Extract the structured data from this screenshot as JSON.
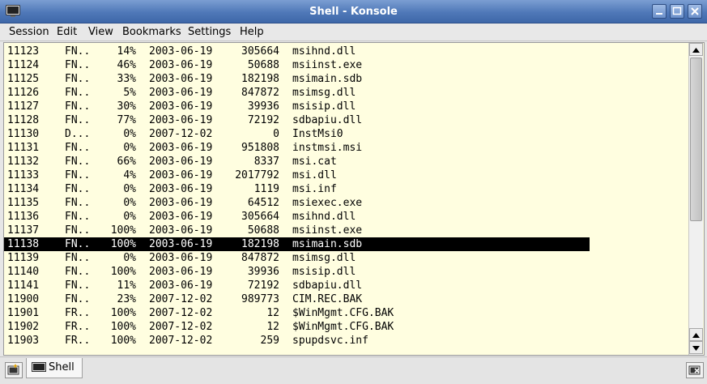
{
  "window": {
    "title": "Shell - Konsole"
  },
  "menu": [
    "Session",
    "Edit",
    "View",
    "Bookmarks",
    "Settings",
    "Help"
  ],
  "terminal": {
    "selected_index": 14,
    "rows": [
      {
        "id": "11123",
        "flags": "FN..",
        "pct": "14%",
        "date": "2003-06-19",
        "size": "305664",
        "name": "msihnd.dll"
      },
      {
        "id": "11124",
        "flags": "FN..",
        "pct": "46%",
        "date": "2003-06-19",
        "size": "50688",
        "name": "msiinst.exe"
      },
      {
        "id": "11125",
        "flags": "FN..",
        "pct": "33%",
        "date": "2003-06-19",
        "size": "182198",
        "name": "msimain.sdb"
      },
      {
        "id": "11126",
        "flags": "FN..",
        "pct": "5%",
        "date": "2003-06-19",
        "size": "847872",
        "name": "msimsg.dll"
      },
      {
        "id": "11127",
        "flags": "FN..",
        "pct": "30%",
        "date": "2003-06-19",
        "size": "39936",
        "name": "msisip.dll"
      },
      {
        "id": "11128",
        "flags": "FN..",
        "pct": "77%",
        "date": "2003-06-19",
        "size": "72192",
        "name": "sdbapiu.dll"
      },
      {
        "id": "11130",
        "flags": "D...",
        "pct": "0%",
        "date": "2007-12-02",
        "size": "0",
        "name": "InstMsi0"
      },
      {
        "id": "11131",
        "flags": "FN..",
        "pct": "0%",
        "date": "2003-06-19",
        "size": "951808",
        "name": "instmsi.msi"
      },
      {
        "id": "11132",
        "flags": "FN..",
        "pct": "66%",
        "date": "2003-06-19",
        "size": "8337",
        "name": "msi.cat"
      },
      {
        "id": "11133",
        "flags": "FN..",
        "pct": "4%",
        "date": "2003-06-19",
        "size": "2017792",
        "name": "msi.dll"
      },
      {
        "id": "11134",
        "flags": "FN..",
        "pct": "0%",
        "date": "2003-06-19",
        "size": "1119",
        "name": "msi.inf"
      },
      {
        "id": "11135",
        "flags": "FN..",
        "pct": "0%",
        "date": "2003-06-19",
        "size": "64512",
        "name": "msiexec.exe"
      },
      {
        "id": "11136",
        "flags": "FN..",
        "pct": "0%",
        "date": "2003-06-19",
        "size": "305664",
        "name": "msihnd.dll"
      },
      {
        "id": "11137",
        "flags": "FN..",
        "pct": "100%",
        "date": "2003-06-19",
        "size": "50688",
        "name": "msiinst.exe"
      },
      {
        "id": "11138",
        "flags": "FN..",
        "pct": "100%",
        "date": "2003-06-19",
        "size": "182198",
        "name": "msimain.sdb"
      },
      {
        "id": "11139",
        "flags": "FN..",
        "pct": "0%",
        "date": "2003-06-19",
        "size": "847872",
        "name": "msimsg.dll"
      },
      {
        "id": "11140",
        "flags": "FN..",
        "pct": "100%",
        "date": "2003-06-19",
        "size": "39936",
        "name": "msisip.dll"
      },
      {
        "id": "11141",
        "flags": "FN..",
        "pct": "11%",
        "date": "2003-06-19",
        "size": "72192",
        "name": "sdbapiu.dll"
      },
      {
        "id": "11900",
        "flags": "FN..",
        "pct": "23%",
        "date": "2007-12-02",
        "size": "989773",
        "name": "CIM.REC.BAK"
      },
      {
        "id": "11901",
        "flags": "FR..",
        "pct": "100%",
        "date": "2007-12-02",
        "size": "12",
        "name": "$WinMgmt.CFG.BAK"
      },
      {
        "id": "11902",
        "flags": "FR..",
        "pct": "100%",
        "date": "2007-12-02",
        "size": "12",
        "name": "$WinMgmt.CFG.BAK"
      },
      {
        "id": "11903",
        "flags": "FR..",
        "pct": "100%",
        "date": "2007-12-02",
        "size": "259",
        "name": "spupdsvc.inf"
      }
    ]
  },
  "tabs": [
    {
      "label": "Shell",
      "icon": "terminal-icon"
    }
  ],
  "colors": {
    "terminal_bg": "#fffee0",
    "selection_bg": "#000000",
    "selection_fg": "#ffffff",
    "titlebar": "#4f78b8"
  }
}
